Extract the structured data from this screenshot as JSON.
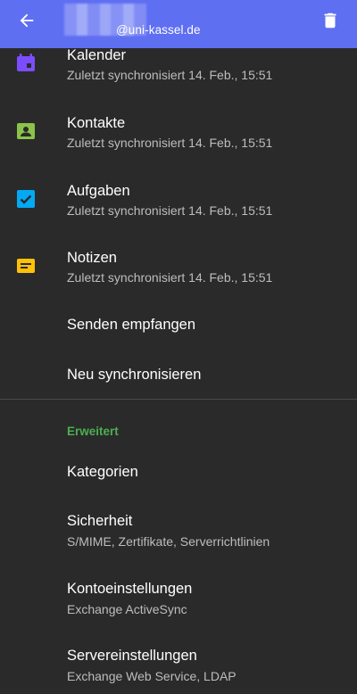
{
  "appbar": {
    "account_domain": "@uni-kassel.de",
    "back_icon": "arrow-left-icon",
    "delete_icon": "trash-icon",
    "color": "#5f6ff2"
  },
  "sync_items": [
    {
      "title": "Kalender",
      "subtitle": "Zuletzt synchronisiert 14. Feb., 15:51",
      "icon": "calendar-icon",
      "color": "#7c4dff"
    },
    {
      "title": "Kontakte",
      "subtitle": "Zuletzt synchronisiert 14. Feb., 15:51",
      "icon": "contact-card-icon",
      "color": "#8bc34a"
    },
    {
      "title": "Aufgaben",
      "subtitle": "Zuletzt synchronisiert 14. Feb., 15:51",
      "icon": "checkbox-icon",
      "color": "#03a9f4"
    },
    {
      "title": "Notizen",
      "subtitle": "Zuletzt synchronisiert 14. Feb., 15:51",
      "icon": "note-icon",
      "color": "#ffc107"
    }
  ],
  "actions": {
    "send_receive": "Senden empfangen",
    "resync": "Neu synchronisieren"
  },
  "advanced": {
    "header": "Erweitert",
    "header_color": "#4caf50",
    "categories": "Kategorien",
    "security_title": "Sicherheit",
    "security_subtitle": "S/MIME, Zertifikate, Serverrichtlinien",
    "account_settings_title": "Kontoeinstellungen",
    "account_settings_subtitle": "Exchange ActiveSync",
    "server_settings_title": "Servereinstellungen",
    "server_settings_subtitle": "Exchange Web Service, LDAP"
  }
}
